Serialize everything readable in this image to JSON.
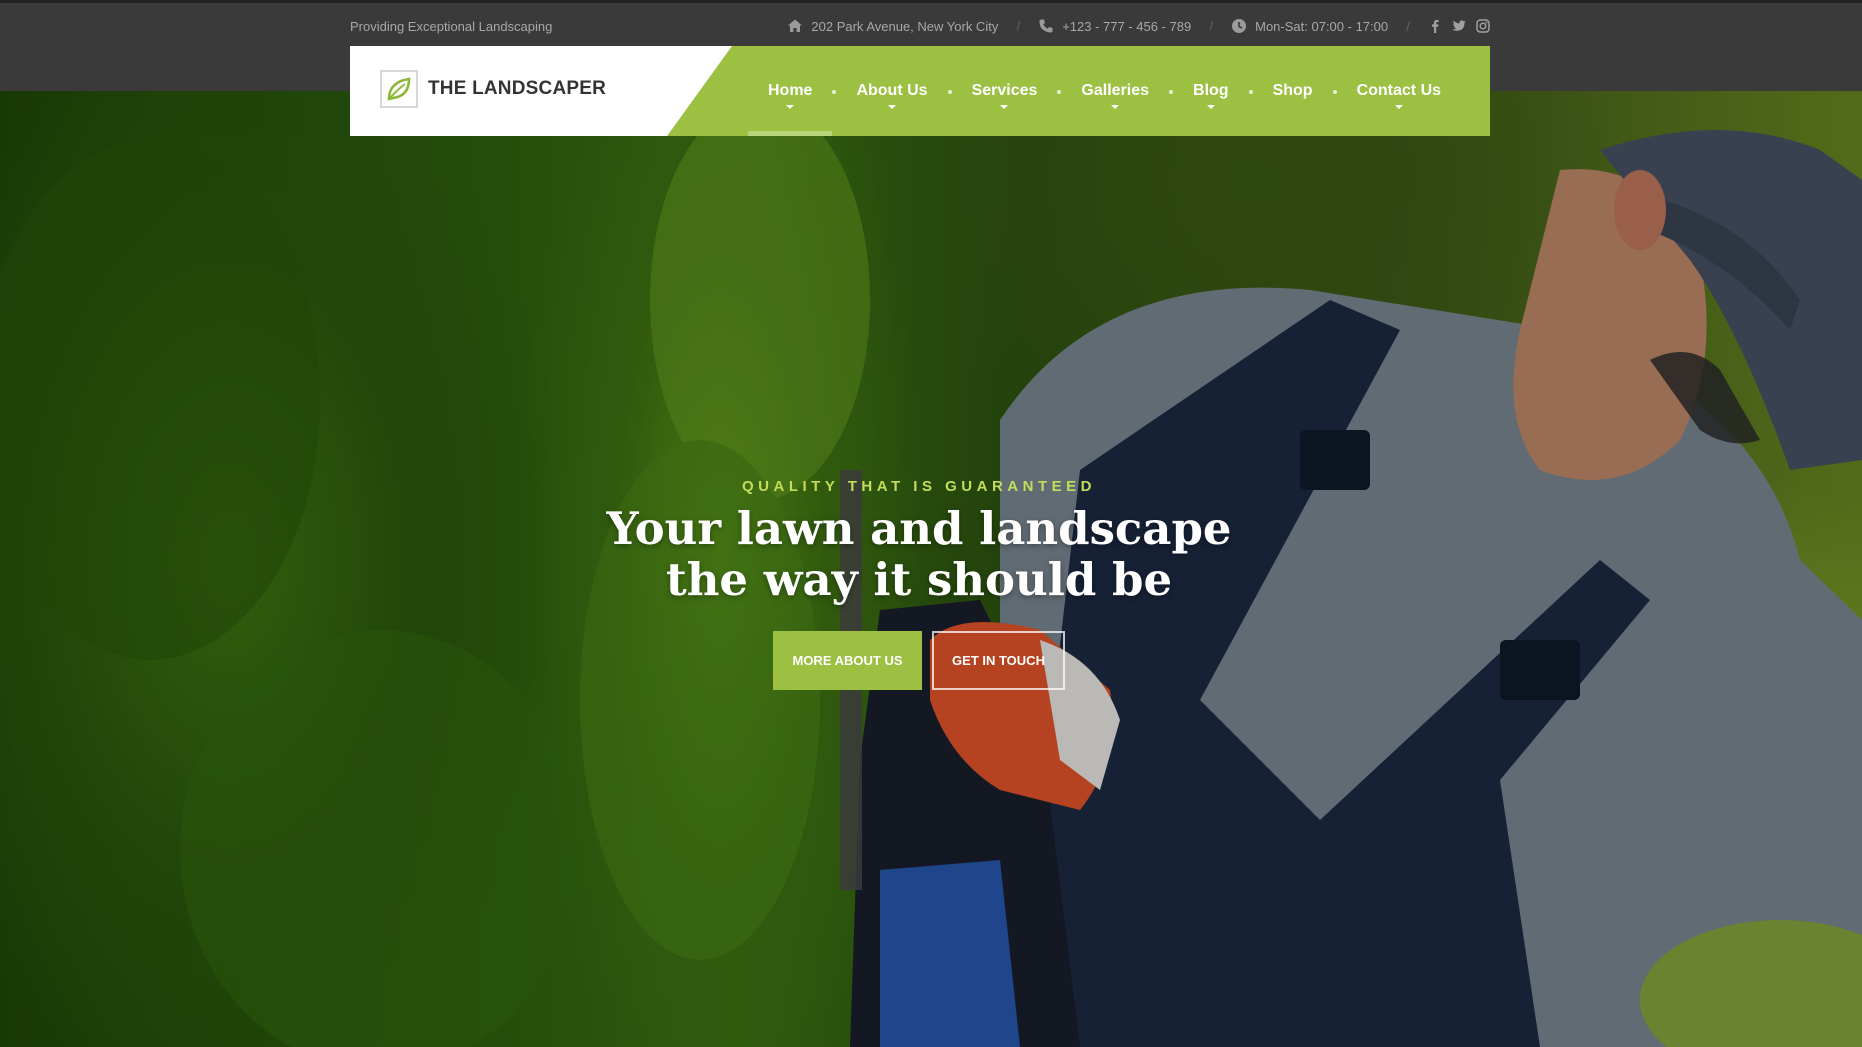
{
  "topbar": {
    "tagline": "Providing Exceptional Landscaping",
    "address": "202 Park Avenue, New York City",
    "phone": "+123 - 777 - 456 - 789",
    "hours": "Mon-Sat: 07:00 - 17:00",
    "separator": "/",
    "icons": {
      "address": "home-icon",
      "phone": "phone-icon",
      "hours": "clock-icon"
    },
    "social": [
      "facebook-icon",
      "twitter-icon",
      "instagram-icon"
    ]
  },
  "header": {
    "logo_text": "THE LANDSCAPER",
    "logo_icon": "leaf-icon",
    "nav": [
      {
        "label": "Home",
        "active": true
      },
      {
        "label": "About Us",
        "active": false
      },
      {
        "label": "Services",
        "active": false
      },
      {
        "label": "Galleries",
        "active": false
      },
      {
        "label": "Blog",
        "active": false
      },
      {
        "label": "Shop",
        "active": false
      },
      {
        "label": "Contact Us",
        "active": false
      }
    ]
  },
  "hero": {
    "eyebrow": "QUALITY THAT IS GUARANTEED",
    "headline_line1": "Your lawn and landscape",
    "headline_line2": "the way it should be",
    "primary_cta": "MORE ABOUT US",
    "secondary_cta": "GET IN TOUCH"
  },
  "colors": {
    "accent": "#9bc042",
    "eyebrow": "#c3dc5a",
    "topbar": "#3a3a3a"
  }
}
